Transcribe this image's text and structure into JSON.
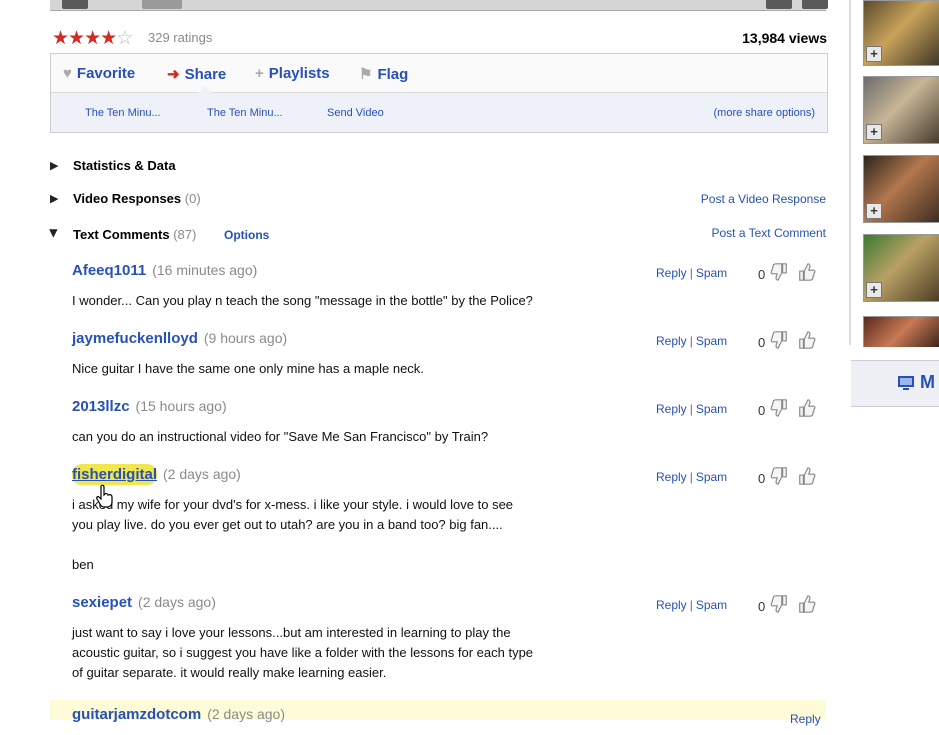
{
  "video": {
    "stars_filled": 4,
    "stars_total": 5,
    "ratings": "329 ratings",
    "views": "13,984 views"
  },
  "actions": {
    "favorite": "Favorite",
    "share": "Share",
    "playlists": "Playlists",
    "flag": "Flag"
  },
  "share_panel": {
    "link1": "The Ten Minu...",
    "link2": "The Ten Minu...",
    "link3": "Send Video",
    "more": "(more share options)"
  },
  "sections": {
    "stats": "Statistics & Data",
    "responses": "Video Responses",
    "responses_count": "(0)",
    "post_response": "Post a Video Response",
    "comments": "Text Comments",
    "comments_count": "(87)",
    "options": "Options",
    "post_comment": "Post a Text Comment"
  },
  "comment_actions": {
    "reply": "Reply",
    "sep": "|",
    "spam": "Spam",
    "score": "0"
  },
  "comments": [
    {
      "user": "Afeeq1011",
      "when": "(16 minutes ago)",
      "lines": [
        "I wonder... Can you play n teach the song \"message in the bottle\" by the Police?"
      ]
    },
    {
      "user": "jaymefuckenlloyd",
      "when": "(9 hours ago)",
      "lines": [
        "Nice guitar I have the same one only mine has a maple neck."
      ]
    },
    {
      "user": "2013llzc",
      "when": "(15 hours ago)",
      "lines": [
        "can you do an instructional video for \"Save Me San Francisco\" by Train?"
      ]
    },
    {
      "user": "fisherdigital",
      "when": "(2 days ago)",
      "lines": [
        "i asked my wife for your dvd's for x-mess. i like your style. i would love to see",
        "you play live. do you ever get out to utah? are you in a band too? big fan....",
        "",
        "ben"
      ]
    },
    {
      "user": "sexiepet",
      "when": "(2 days ago)",
      "lines": [
        "just want to say i love your lessons...but am interested in learning to play the",
        "acoustic guitar, so i suggest you have like a folder with the lessons for each type",
        "of guitar separate. it would really make learning easier."
      ]
    },
    {
      "user": "guitarjamzdotcom",
      "when": "(2 days ago)",
      "lines": []
    }
  ],
  "partial_reply": "Reply",
  "sidebar_partial_label": "M",
  "colors": {
    "link": "#2750b8",
    "star": "#d42a1f",
    "highlight": "#fdfbd8"
  }
}
